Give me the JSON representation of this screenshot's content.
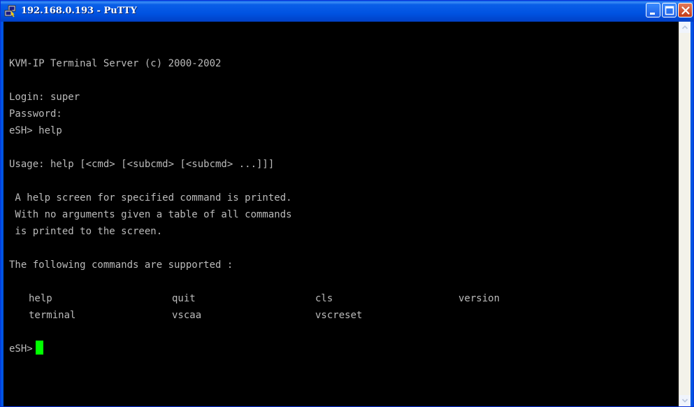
{
  "window": {
    "title": "192.168.0.193 - PuTTY"
  },
  "terminal": {
    "banner": "KVM-IP Terminal Server (c) 2000-2002",
    "login_line": "Login: super",
    "password_line": "Password:",
    "help_command_line": "eSH> help",
    "usage_line": "Usage: help [<cmd> [<subcmd> [<subcmd> ...]]]",
    "description": [
      " A help screen for specified command is printed.",
      " With no arguments given a table of all commands",
      " is printed to the screen."
    ],
    "supported_header": "The following commands are supported :",
    "commands": [
      [
        "help",
        "quit",
        "cls",
        "version"
      ],
      [
        "terminal",
        "vscaa",
        "vscreset",
        ""
      ]
    ],
    "prompt": "eSH>"
  },
  "colors": {
    "terminal_bg": "#000000",
    "terminal_fg": "#bbbbbb",
    "cursor": "#00ff00",
    "titlebar": "#0054e3"
  },
  "icons": {
    "app": "putty-icon",
    "minimize": "minimize-icon",
    "maximize": "maximize-icon",
    "close": "close-icon",
    "scroll_up": "arrow-up-icon",
    "scroll_down": "arrow-down-icon"
  }
}
